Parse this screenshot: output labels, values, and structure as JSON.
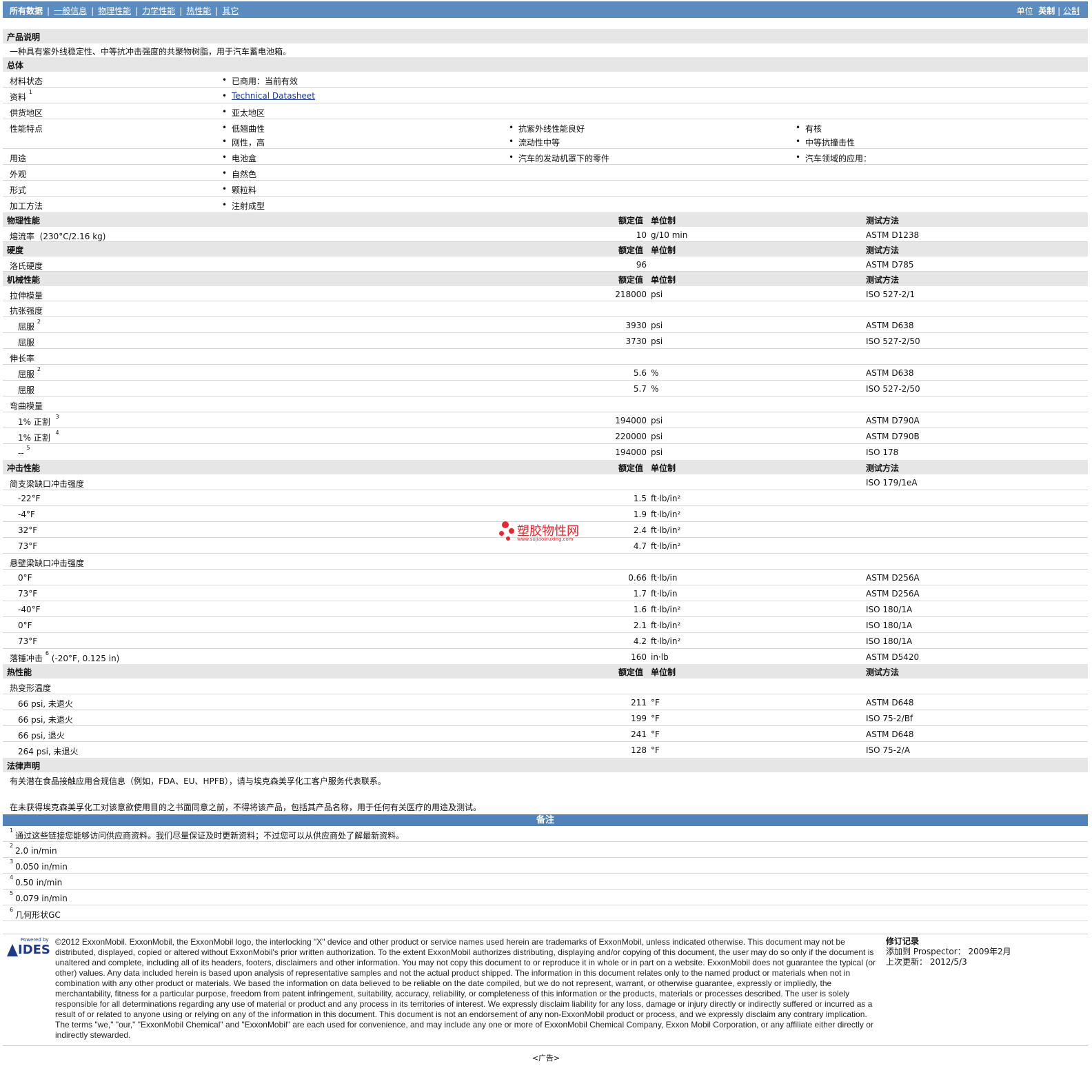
{
  "nav": {
    "items": [
      "所有数据",
      "一般信息",
      "物理性能",
      "力学性能",
      "热性能",
      "其它"
    ],
    "units_label": "单位",
    "units_english": "英制",
    "units_metric": "公制"
  },
  "product": {
    "header": "产品说明",
    "description": "一种具有紫外线稳定性、中等抗冲击强度的共聚物树脂，用于汽车蓄电池箱。"
  },
  "general": {
    "header": "总体",
    "material_status_label": "材料状态",
    "material_status": "已商用：当前有效",
    "literature_label": "资料",
    "literature_sup": "1",
    "literature_link": "Technical Datasheet",
    "availability_label": "供货地区",
    "availability": "亚太地区",
    "features_label": "性能特点",
    "features": [
      "低翘曲性",
      "抗紫外线性能良好",
      "有核",
      "刚性，高",
      "流动性中等",
      "中等抗撞击性"
    ],
    "uses_label": "用途",
    "uses": [
      "电池盒",
      "汽车的发动机罩下的零件",
      "汽车领域的应用："
    ],
    "appearance_label": "外观",
    "appearance": "自然色",
    "form_label": "形式",
    "form": "颗粒料",
    "processing_label": "加工方法",
    "processing": "注射成型"
  },
  "col_headers": {
    "nominal": "额定值",
    "unit": "单位制",
    "method": "测试方法"
  },
  "physical": {
    "header": "物理性能",
    "mfr_label": "熔流率",
    "mfr_cond": "(230°C/2.16 kg)",
    "mfr_val": "10",
    "mfr_unit": "g/10 min",
    "mfr_method": "ASTM D1238"
  },
  "hardness": {
    "header": "硬度",
    "label": "洛氏硬度",
    "val": "96",
    "method": "ASTM D785"
  },
  "mechanical": {
    "header": "机械性能",
    "tm_label": "拉伸模量",
    "tm_val": "218000",
    "tm_unit": "psi",
    "tm_method": "ISO 527-2/1",
    "ts_label": "抗张强度",
    "ts1_label": "屈服",
    "ts1_sup": "2",
    "ts1_val": "3930",
    "ts1_unit": "psi",
    "ts1_method": "ASTM D638",
    "ts2_label": "屈服",
    "ts2_val": "3730",
    "ts2_unit": "psi",
    "ts2_method": "ISO 527-2/50",
    "el_label": "伸长率",
    "el1_label": "屈服",
    "el1_sup": "2",
    "el1_val": "5.6",
    "el1_unit": "%",
    "el1_method": "ASTM D638",
    "el2_label": "屈服",
    "el2_val": "5.7",
    "el2_unit": "%",
    "el2_method": "ISO 527-2/50",
    "fm_label": "弯曲模量",
    "fm1_label": "1% 正割",
    "fm1_sup": "3",
    "fm1_val": "194000",
    "fm1_unit": "psi",
    "fm1_method": "ASTM D790A",
    "fm2_label": "1% 正割",
    "fm2_sup": "4",
    "fm2_val": "220000",
    "fm2_unit": "psi",
    "fm2_method": "ASTM D790B",
    "fm3_label": "--",
    "fm3_sup": "5",
    "fm3_val": "194000",
    "fm3_unit": "psi",
    "fm3_method": "ISO 178"
  },
  "impact": {
    "header": "冲击性能",
    "charpy_label": "简支梁缺口冲击强度",
    "charpy_method": "ISO 179/1eA",
    "charpy": [
      {
        "t": "-22°F",
        "v": "1.5",
        "u": "ft·lb/in²"
      },
      {
        "t": "-4°F",
        "v": "1.9",
        "u": "ft·lb/in²"
      },
      {
        "t": "32°F",
        "v": "2.4",
        "u": "ft·lb/in²"
      },
      {
        "t": "73°F",
        "v": "4.7",
        "u": "ft·lb/in²"
      }
    ],
    "izod_label": "悬壁梁缺口冲击强度",
    "izod": [
      {
        "t": "0°F",
        "v": "0.66",
        "u": "ft·lb/in",
        "m": "ASTM D256A"
      },
      {
        "t": "73°F",
        "v": "1.7",
        "u": "ft·lb/in",
        "m": "ASTM D256A"
      },
      {
        "t": "-40°F",
        "v": "1.6",
        "u": "ft·lb/in²",
        "m": "ISO 180/1A"
      },
      {
        "t": "0°F",
        "v": "2.1",
        "u": "ft·lb/in²",
        "m": "ISO 180/1A"
      },
      {
        "t": "73°F",
        "v": "4.2",
        "u": "ft·lb/in²",
        "m": "ISO 180/1A"
      }
    ],
    "dart_label": "落锤冲击",
    "dart_sup": "6",
    "dart_cond": "(-20°F, 0.125 in)",
    "dart_val": "160",
    "dart_unit": "in·lb",
    "dart_method": "ASTM D5420"
  },
  "thermal": {
    "header": "热性能",
    "hdt_label": "热变形温度",
    "rows": [
      {
        "l": "66 psi, 未退火",
        "v": "211",
        "u": "°F",
        "m": "ASTM D648"
      },
      {
        "l": "66 psi, 未退火",
        "v": "199",
        "u": "°F",
        "m": "ISO 75-2/Bf"
      },
      {
        "l": "66 psi, 退火",
        "v": "241",
        "u": "°F",
        "m": "ASTM D648"
      },
      {
        "l": "264 psi, 未退火",
        "v": "128",
        "u": "°F",
        "m": "ISO 75-2/A"
      }
    ]
  },
  "legal": {
    "header": "法律声明",
    "line1": "有关潜在食品接触应用合规信息（例如，FDA、EU、HPFB），请与埃克森美孚化工客户服务代表联系。",
    "line2": "在未获得埃克森美孚化工对该意欲使用目的之书面同意之前，不得将该产品，包括其产品名称，用于任何有关医疗的用途及测试。"
  },
  "notes": {
    "header": "备注",
    "items": [
      {
        "n": "1",
        "t": "通过这些链接您能够访问供应商资料。我们尽量保证及时更新资料；不过您可以从供应商处了解最新资料。"
      },
      {
        "n": "2",
        "t": "2.0 in/min"
      },
      {
        "n": "3",
        "t": "0.050 in/min"
      },
      {
        "n": "4",
        "t": "0.50 in/min"
      },
      {
        "n": "5",
        "t": "0.079 in/min"
      },
      {
        "n": "6",
        "t": "几何形状GC"
      }
    ]
  },
  "watermark": {
    "text": "塑胶物性网",
    "url": "www.sujiaowuxing.com"
  },
  "footer": {
    "logo_powered": "Powered by",
    "logo_text": "IDES",
    "copyright": "©2012 ExxonMobil. ExxonMobil, the ExxonMobil logo, the interlocking \"X\" device and other product or service names used herein are trademarks of ExxonMobil, unless indicated otherwise. This document may not be distributed, displayed, copied or altered without ExxonMobil's prior written authorization. To the extent ExxonMobil authorizes distributing, displaying and/or copying of this document, the user may do so only if the document is unaltered and complete, including all of its headers, footers, disclaimers and other information. You may not copy this document to or reproduce it in whole or in part on a website. ExxonMobil does not guarantee the typical (or other) values. Any data included herein is based upon analysis of representative samples and not the actual product shipped. The information in this document relates only to the named product or materials when not in combination with any other product or materials. We based the information on data believed to be reliable on the date compiled, but we do not represent, warrant, or otherwise guarantee, expressly or impliedly, the merchantability, fitness for a particular purpose, freedom from patent infringement, suitability, accuracy, reliability, or completeness of this information or the products, materials or processes described. The user is solely responsible for all determinations regarding any use of material or product and any process in its territories of interest. We expressly disclaim liability for any loss, damage or injury directly or indirectly suffered or incurred as a result of or related to anyone using or relying on any of the information in this document. This document is not an endorsement of any non-ExxonMobil product or process, and we expressly disclaim any contrary implication. The terms \"we,\" \"our,\" \"ExxonMobil Chemical\" and \"ExxonMobil\" are each used for convenience, and may include any one or more of ExxonMobil Chemical Company, Exxon Mobil Corporation, or any affiliate either directly or indirectly stewarded.",
    "rev_title": "修订记录",
    "rev_added": "添加到 Prospector：  2009年2月",
    "rev_updated": "上次更新：  2012/5/3",
    "ad": "<广告>"
  }
}
